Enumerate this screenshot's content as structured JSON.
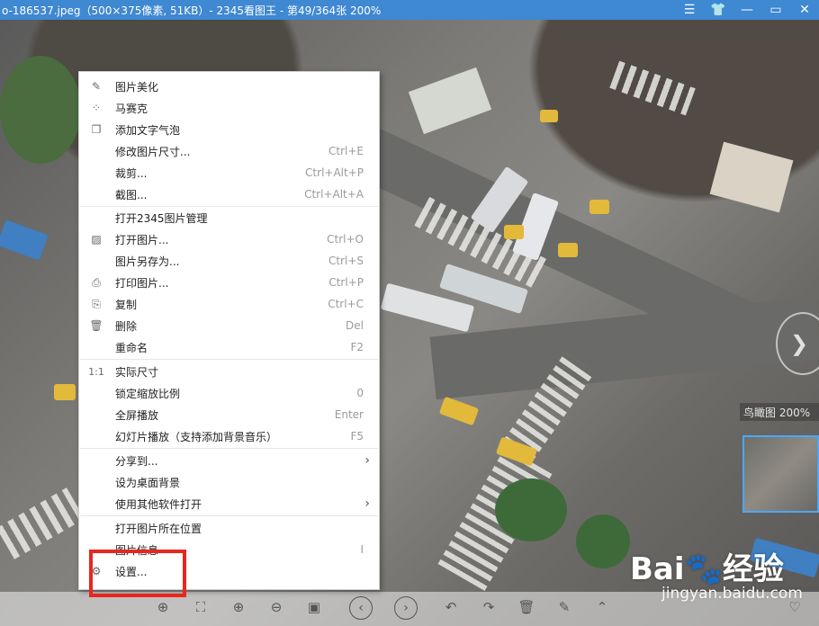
{
  "window": {
    "title": "o-186537.jpeg（500×375像素, 51KB）- 2345看图王 - 第49/364张 200%",
    "controls": [
      "menu-icon",
      "skin-icon",
      "minimize-icon",
      "maximize-icon",
      "close-icon"
    ]
  },
  "menu": {
    "items": [
      {
        "label": "图片美化",
        "shortcut": "",
        "icon": "edit-icon"
      },
      {
        "label": "马赛克",
        "shortcut": "",
        "icon": "mosaic-icon"
      },
      {
        "label": "添加文字气泡",
        "shortcut": "",
        "icon": "bubble-icon"
      },
      {
        "label": "修改图片尺寸...",
        "shortcut": "Ctrl+E",
        "icon": ""
      },
      {
        "label": "裁剪...",
        "shortcut": "Ctrl+Alt+P",
        "icon": ""
      },
      {
        "label": "截图...",
        "shortcut": "Ctrl+Alt+A",
        "icon": ""
      },
      {
        "label": "打开2345图片管理",
        "shortcut": "",
        "icon": ""
      },
      {
        "label": "打开图片...",
        "shortcut": "Ctrl+O",
        "icon": "image-icon"
      },
      {
        "label": "图片另存为...",
        "shortcut": "Ctrl+S",
        "icon": ""
      },
      {
        "label": "打印图片...",
        "shortcut": "Ctrl+P",
        "icon": "print-icon"
      },
      {
        "label": "复制",
        "shortcut": "Ctrl+C",
        "icon": "copy-icon"
      },
      {
        "label": "删除",
        "shortcut": "Del",
        "icon": "trash-icon"
      },
      {
        "label": "重命名",
        "shortcut": "F2",
        "icon": ""
      },
      {
        "label": "实际尺寸",
        "shortcut": "",
        "icon": "actual-size-icon"
      },
      {
        "label": "锁定缩放比例",
        "shortcut": "0",
        "icon": ""
      },
      {
        "label": "全屏播放",
        "shortcut": "Enter",
        "icon": ""
      },
      {
        "label": "幻灯片播放（支持添加背景音乐）",
        "shortcut": "F5",
        "icon": ""
      },
      {
        "label": "分享到...",
        "shortcut": "",
        "icon": "",
        "submenu": true
      },
      {
        "label": "设为桌面背景",
        "shortcut": "",
        "icon": ""
      },
      {
        "label": "使用其他软件打开",
        "shortcut": "",
        "icon": "",
        "submenu": true
      },
      {
        "label": "打开图片所在位置",
        "shortcut": "",
        "icon": ""
      },
      {
        "label": "图片信息",
        "shortcut": "I",
        "icon": ""
      },
      {
        "label": "设置...",
        "shortcut": "",
        "icon": "gear-icon"
      }
    ],
    "actual_size_glyph": "1:1"
  },
  "birdview": {
    "label": "鸟瞰图 200%"
  },
  "watermark": {
    "logo": "Bai",
    "logo_cn": "经验",
    "url": "jingyan.baidu.com"
  }
}
